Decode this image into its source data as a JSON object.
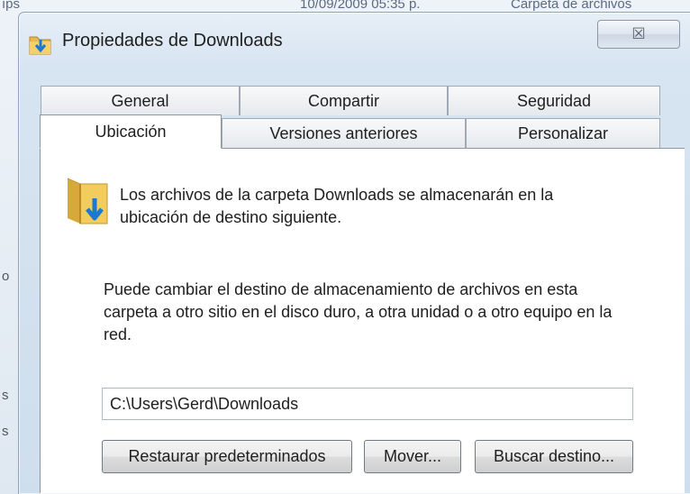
{
  "background": {
    "top_left_fragment": "ıps",
    "top_mid_fragment": "10/09/2009 05:35 p.",
    "top_right_fragment": "Carpeta de archivos",
    "side_marks": [
      "o",
      "s",
      "s"
    ]
  },
  "window": {
    "title": "Propiedades de Downloads",
    "close_symbol": "☒"
  },
  "tabs_row1": [
    "General",
    "Compartir",
    "Seguridad"
  ],
  "tabs_row2": [
    "Ubicación",
    "Versiones anteriores",
    "Personalizar"
  ],
  "selected_tab": "Ubicación",
  "location": {
    "info": "Los archivos de la carpeta Downloads se almacenarán en la ubicación de destino siguiente.",
    "description": "Puede cambiar el destino de almacenamiento de archivos en esta carpeta a otro sitio en el disco duro, a otra unidad o a otro equipo en la red.",
    "path_value": "C:\\Users\\Gerd\\Downloads",
    "buttons": {
      "restore": "Restaurar predeterminados",
      "move": "Mover...",
      "find_target": "Buscar destino..."
    }
  },
  "icons": {
    "title_icon": "folder-download-icon",
    "info_icon": "folder-download-large-icon",
    "close_icon": "close-icon"
  },
  "colors": {
    "folder": "#e8b84a",
    "arrow": "#1b79d4",
    "window_frame": "#cfdeed"
  }
}
